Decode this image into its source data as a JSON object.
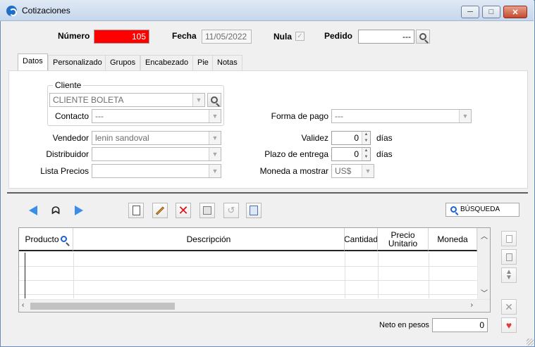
{
  "window": {
    "title": "Cotizaciones",
    "controls": {
      "minimize": "─",
      "maximize": "□",
      "close": "✕"
    }
  },
  "header": {
    "numero_label": "Número",
    "numero_value": "105",
    "fecha_label": "Fecha",
    "fecha_value": "11/05/2022",
    "nula_label": "Nula",
    "nula_checked": true,
    "pedido_label": "Pedido",
    "pedido_value": "---"
  },
  "tabs": [
    {
      "label": "Datos",
      "active": true
    },
    {
      "label": "Personalizado"
    },
    {
      "label": "Grupos"
    },
    {
      "label": "Encabezado"
    },
    {
      "label": "Pie"
    },
    {
      "label": "Notas"
    }
  ],
  "datos": {
    "cliente_group": "Cliente",
    "cliente_value": "CLIENTE BOLETA",
    "contacto_label": "Contacto",
    "contacto_value": "---",
    "vendedor_label": "Vendedor",
    "vendedor_value": "lenin sandoval",
    "distribuidor_label": "Distribuidor",
    "distribuidor_value": "",
    "lista_precios_label": "Lista Precios",
    "lista_precios_value": "",
    "forma_pago_label": "Forma de pago",
    "forma_pago_value": "---",
    "validez_label": "Validez",
    "validez_value": "0",
    "validez_unit": "días",
    "plazo_label": "Plazo de entrega",
    "plazo_value": "0",
    "plazo_unit": "días",
    "moneda_label": "Moneda a mostrar",
    "moneda_value": "US$"
  },
  "toolbar": {
    "busqueda_label": "BÚSQUEDA"
  },
  "grid": {
    "columns": [
      "Producto",
      "Descripción",
      "Cantidad",
      "Precio Unitario",
      "Moneda"
    ],
    "rows": [
      [
        "",
        "",
        "",
        "",
        ""
      ],
      [
        "",
        "",
        "",
        "",
        ""
      ],
      [
        "",
        "",
        "",
        "",
        ""
      ]
    ]
  },
  "footer": {
    "neto_label": "Neto en pesos",
    "neto_value": "0"
  },
  "colors": {
    "numero_bg": "#ff0000",
    "nav_arrow": "#3b8ee6",
    "delete_red": "#dd1111"
  }
}
